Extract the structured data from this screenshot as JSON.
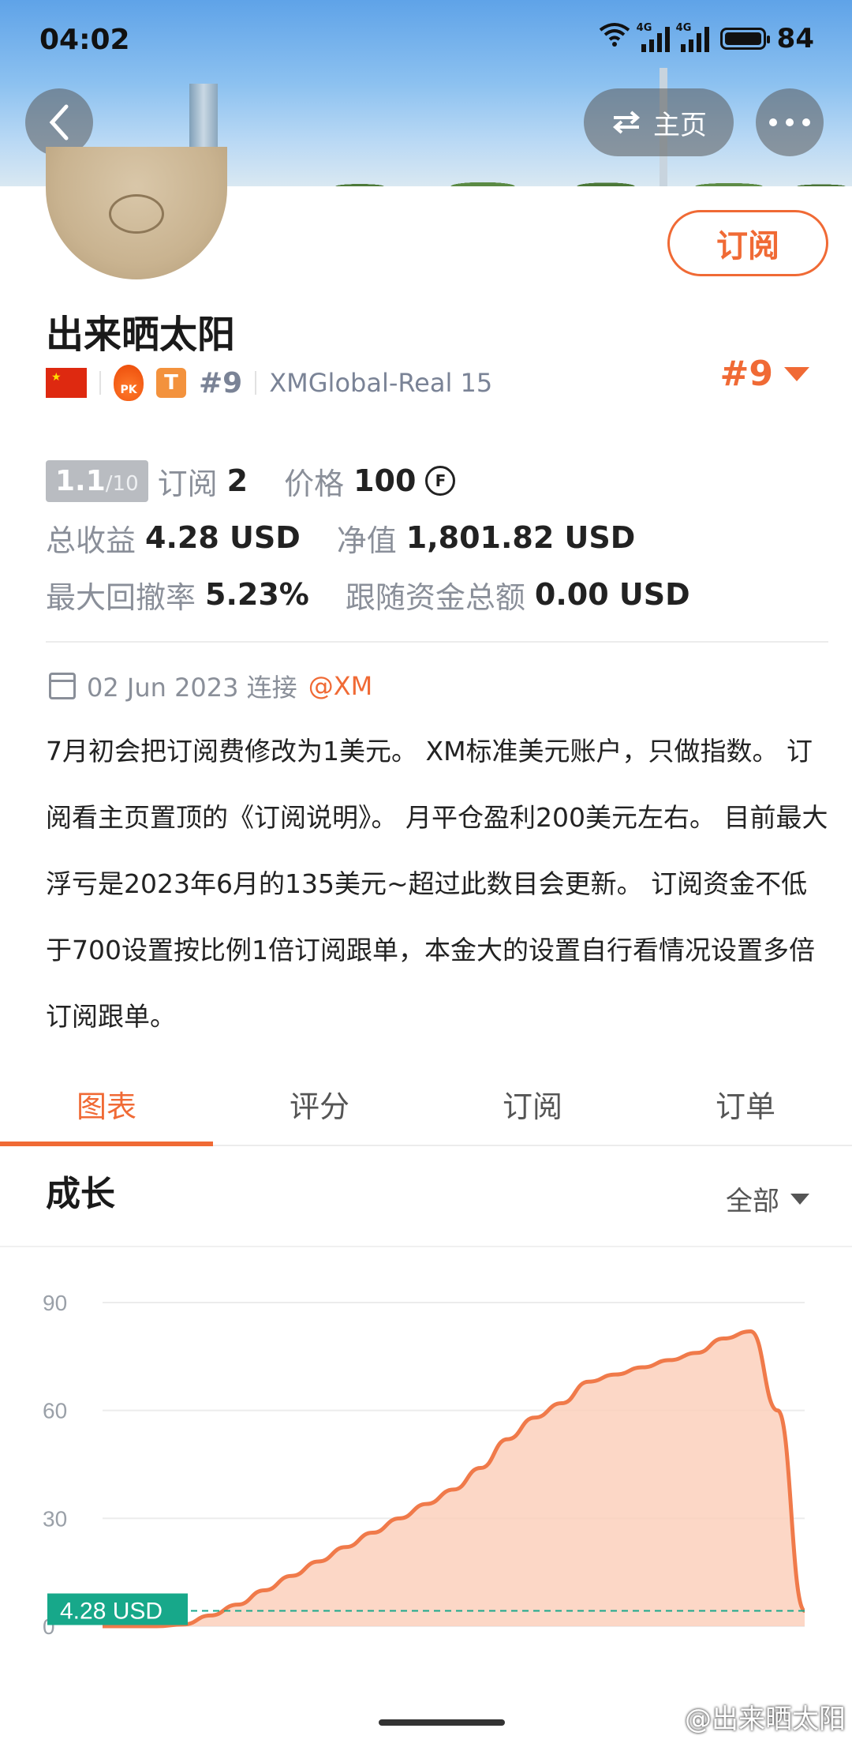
{
  "status_bar": {
    "time": "04:02",
    "net1": "4G",
    "net2": "4G",
    "battery": "84"
  },
  "nav": {
    "home_label": "主页"
  },
  "profile": {
    "subscribe_label": "订阅",
    "name": "出来晒太阳",
    "pk_badge": "PK",
    "t_badge": "T",
    "rank": "#9",
    "server": "XMGlobal-Real 15",
    "rank_right": "#9"
  },
  "stats": {
    "score": "1.1",
    "score_max": "/10",
    "subscribe_label": "订阅",
    "subscribe_value": "2",
    "price_label": "价格",
    "price_value": "100",
    "coin_icon": "F",
    "total_profit_label": "总收益",
    "total_profit_value": "4.28 USD",
    "equity_label": "净值",
    "equity_value": "1,801.82 USD",
    "max_drawdown_label": "最大回撤率",
    "max_drawdown_value": "5.23%",
    "follow_label": "跟随资金总额",
    "follow_value": "0.00 USD"
  },
  "connect": {
    "date": "02 Jun 2023 连接",
    "broker": "@XM"
  },
  "description": "7月初会把订阅费修改为1美元。 XM标准美元账户，只做指数。 订阅看主页置顶的《订阅说明》。 月平仓盈利200美元左右。 目前最大浮亏是2023年6月的135美元~超过此数目会更新。 订阅资金不低于700设置按比例1倍订阅跟单，本金大的设置自行看情况设置多倍订阅跟单。",
  "tabs": [
    "图表",
    "评分",
    "订阅",
    "订单"
  ],
  "growth": {
    "title": "成长",
    "filter": "全部"
  },
  "chart_data": {
    "type": "area",
    "y_ticks": [
      "90",
      "60",
      "30",
      "0"
    ],
    "ylim": [
      0,
      90
    ],
    "current_label": "4.28 USD",
    "current_value": 4.28,
    "values": [
      0,
      0,
      0,
      0.5,
      3,
      6,
      10,
      14,
      18,
      22,
      26,
      30,
      34,
      38,
      44,
      52,
      58,
      62,
      68,
      70,
      72,
      74,
      76,
      80,
      82,
      60,
      4.28
    ],
    "line_color": "#f07a4a",
    "fill_color": "#fbd0bc"
  },
  "watermark": "@出来晒太阳"
}
